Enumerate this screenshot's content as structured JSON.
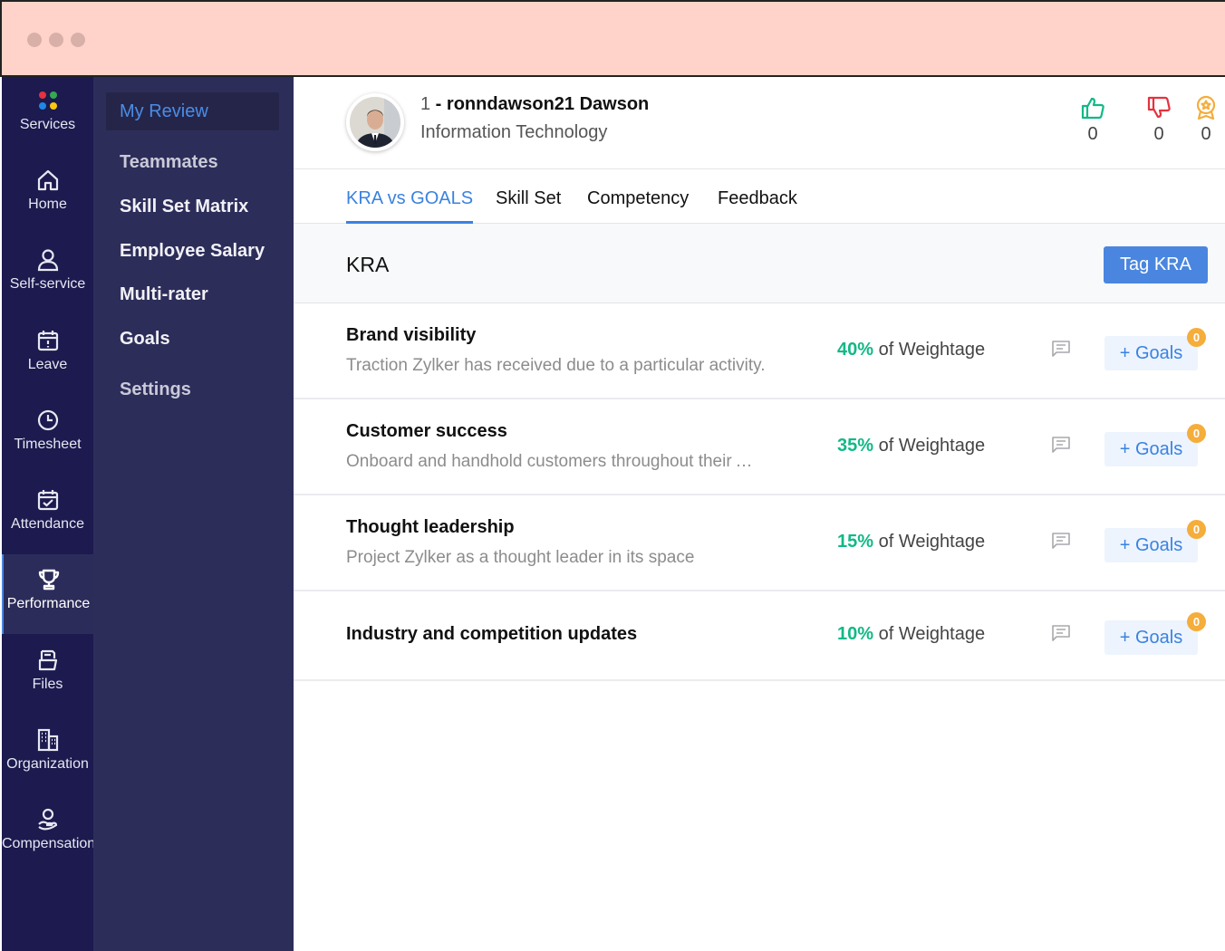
{
  "window": {
    "controls": [
      "close",
      "minimize",
      "maximize"
    ]
  },
  "rail": {
    "items": [
      {
        "label": "Services",
        "icon": "services-grid-icon"
      },
      {
        "label": "Home",
        "icon": "home-icon"
      },
      {
        "label": "Self-service",
        "icon": "user-icon"
      },
      {
        "label": "Leave",
        "icon": "calendar-alert-icon"
      },
      {
        "label": "Timesheet",
        "icon": "clock-icon"
      },
      {
        "label": "Attendance",
        "icon": "calendar-check-icon"
      },
      {
        "label": "Performance",
        "icon": "trophy-icon",
        "active": true
      },
      {
        "label": "Files",
        "icon": "files-icon"
      },
      {
        "label": "Organization",
        "icon": "building-icon"
      },
      {
        "label": "Compensation",
        "icon": "hand-coin-icon"
      }
    ],
    "services_colors": [
      "#e5323e",
      "#34a853",
      "#1e88e5",
      "#f9c80e"
    ]
  },
  "submenu": {
    "items": [
      {
        "label": "My Review",
        "active": true
      },
      {
        "label": "Teammates"
      },
      {
        "label": "Skill Set Matrix"
      },
      {
        "label": "Employee Salary"
      },
      {
        "label": "Multi-rater"
      },
      {
        "label": "Goals"
      },
      {
        "label": "Settings"
      }
    ]
  },
  "profile": {
    "number": "1",
    "separator": " - ",
    "name": "ronndawson21 Dawson",
    "department": "Information Technology",
    "stats": [
      {
        "icon": "thumbs-up-icon",
        "count": "0",
        "color": "#12b886"
      },
      {
        "icon": "thumbs-down-icon",
        "count": "0",
        "color": "#e5323e"
      },
      {
        "icon": "award-icon",
        "count": "0",
        "color": "#f5ad3b"
      }
    ]
  },
  "tabs": [
    {
      "label": "KRA vs GOALS",
      "active": true
    },
    {
      "label": "Skill Set"
    },
    {
      "label": "Competency"
    },
    {
      "label": "Feedback"
    }
  ],
  "kra": {
    "title": "KRA",
    "tag_button": "Tag KRA",
    "weight_suffix": " of Weightage",
    "goals_button": "+ Goals",
    "rows": [
      {
        "title": "Brand visibility",
        "description": "Traction Zylker has received due to a particular activity.",
        "weight": "40%",
        "goal_count": "0"
      },
      {
        "title": "Customer success",
        "description": "Onboard and handhold customers throughout their …",
        "weight": "35%",
        "goal_count": "0"
      },
      {
        "title": "Thought leadership",
        "description": "Project Zylker as a thought leader in its space",
        "weight": "15%",
        "goal_count": "0"
      },
      {
        "title": "Industry and competition updates",
        "description": "",
        "weight": "10%",
        "goal_count": "0"
      }
    ]
  },
  "colors": {
    "accent": "#3a82e0",
    "weight_green": "#12b886",
    "badge_orange": "#f5ad3b",
    "titlebar": "#ffd3c9",
    "rail_bg": "#1c1a4e",
    "submenu_bg": "#2d2d5a"
  }
}
